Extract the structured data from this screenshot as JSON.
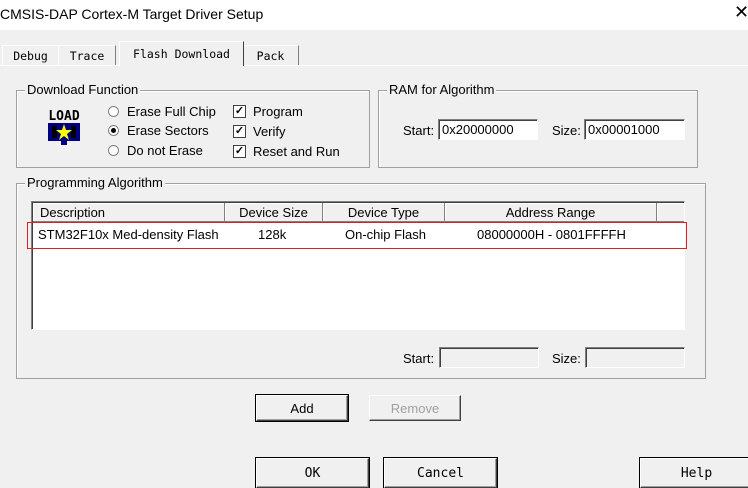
{
  "window": {
    "title": "CMSIS-DAP Cortex-M Target Driver Setup",
    "close_glyph": "✕"
  },
  "tabs": [
    {
      "label": "Debug",
      "active": false
    },
    {
      "label": "Trace",
      "active": false
    },
    {
      "label": "Flash Download",
      "active": true
    },
    {
      "label": "Pack",
      "active": false
    }
  ],
  "download_function": {
    "legend": "Download Function",
    "icon": "load-icon",
    "icon_text": "LOAD",
    "radios": [
      {
        "label": "Erase Full Chip",
        "checked": false
      },
      {
        "label": "Erase Sectors",
        "checked": true
      },
      {
        "label": "Do not Erase",
        "checked": false
      }
    ],
    "checkboxes": [
      {
        "label": "Program",
        "checked": true
      },
      {
        "label": "Verify",
        "checked": true
      },
      {
        "label": "Reset and Run",
        "checked": true
      }
    ]
  },
  "ram_for_algorithm": {
    "legend": "RAM for Algorithm",
    "start_label": "Start:",
    "start_value": "0x20000000",
    "size_label": "Size:",
    "size_value": "0x00001000"
  },
  "programming_algorithm": {
    "legend": "Programming Algorithm",
    "columns": [
      "Description",
      "Device Size",
      "Device Type",
      "Address Range"
    ],
    "rows": [
      {
        "description": "STM32F10x Med-density Flash",
        "device_size": "128k",
        "device_type": "On-chip Flash",
        "address_range": "08000000H - 0801FFFFH"
      }
    ],
    "start_label": "Start:",
    "start_value": "",
    "size_label": "Size:",
    "size_value": ""
  },
  "buttons": {
    "add": "Add",
    "remove": "Remove",
    "ok": "OK",
    "cancel": "Cancel",
    "help": "Help"
  },
  "colors": {
    "highlight_border": "#e02020",
    "dialog_bg": "#f0f0f0"
  }
}
